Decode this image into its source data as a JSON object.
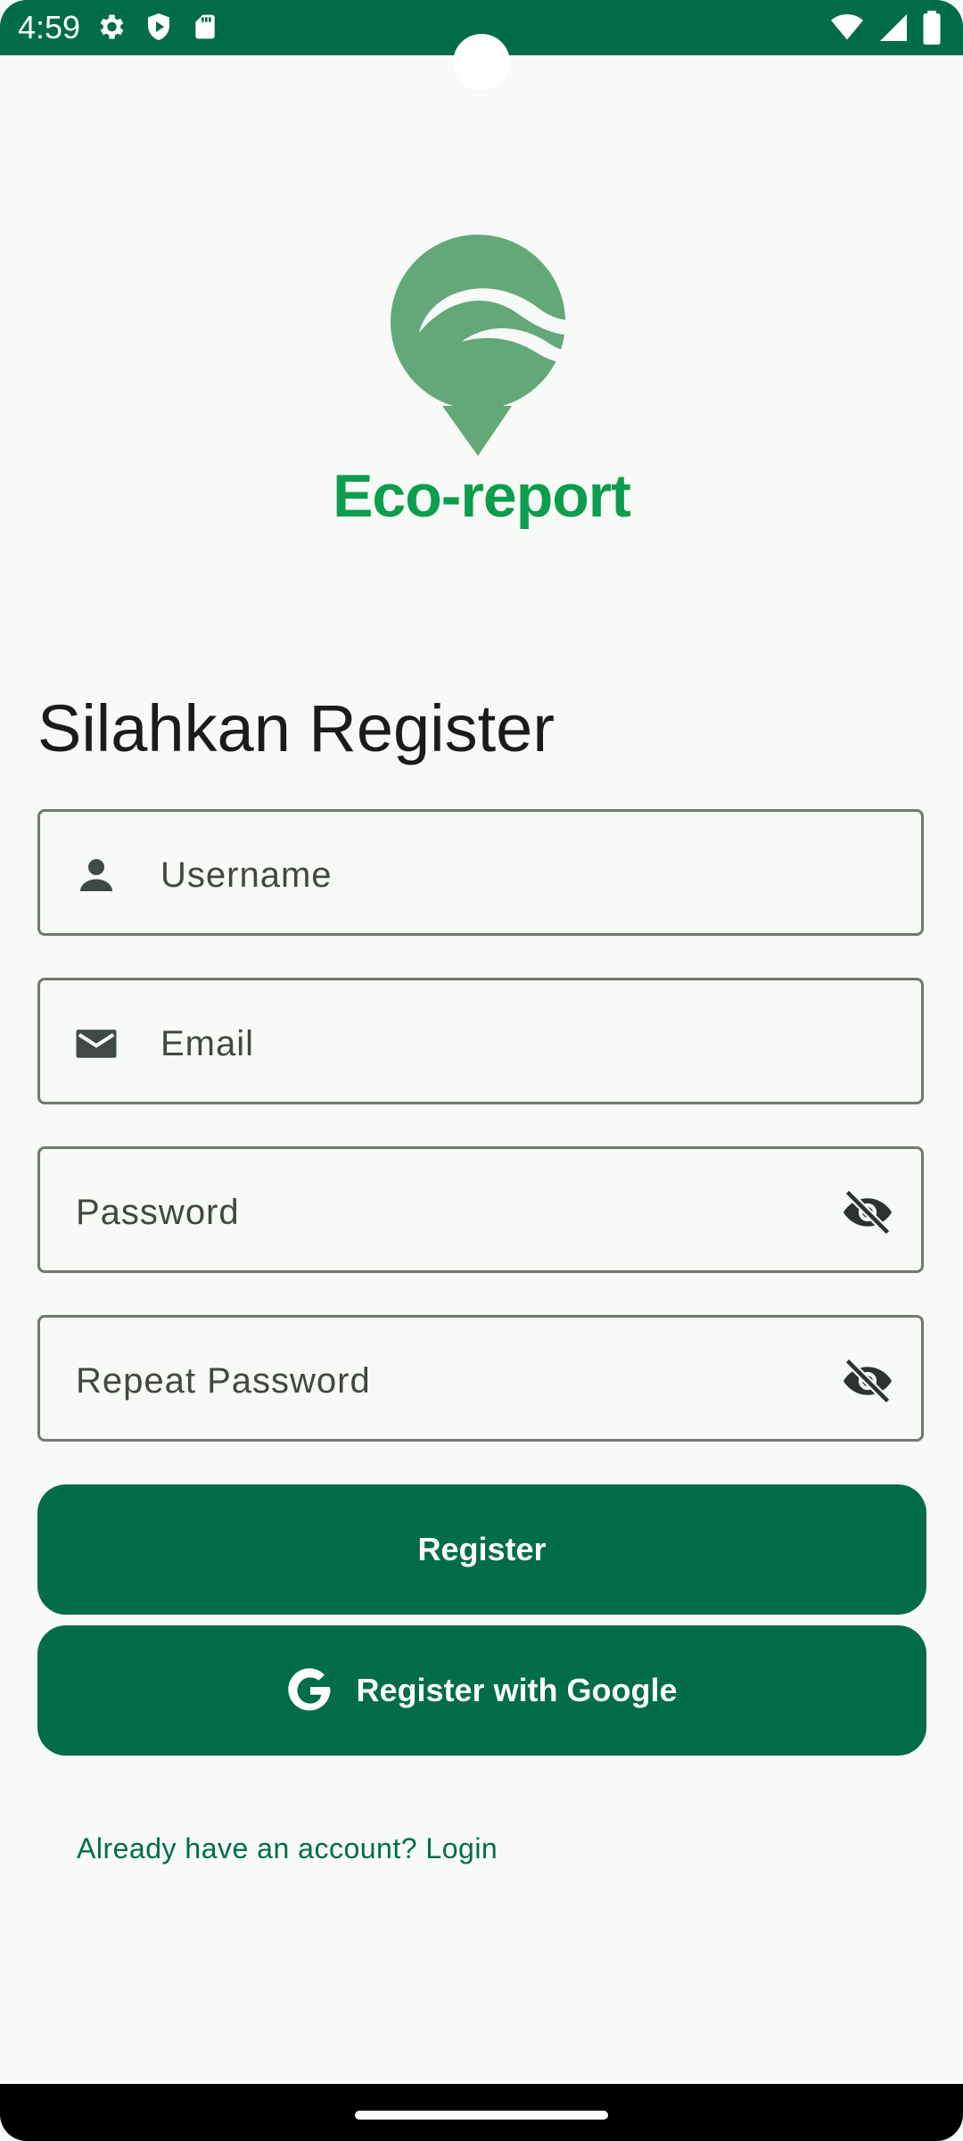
{
  "status_bar": {
    "time": "4:59",
    "left_icons": [
      "gear-icon",
      "shield-play-icon",
      "sd-card-icon"
    ],
    "right_icons": [
      "wifi-icon",
      "signal-icon",
      "battery-icon"
    ]
  },
  "logo": {
    "text": "Eco-report",
    "color": "#0c9d4e",
    "mark_color": "#63a879"
  },
  "heading": "Silahkan Register",
  "form": {
    "username": {
      "placeholder": "Username",
      "icon": "person-icon"
    },
    "email": {
      "placeholder": "Email",
      "icon": "mail-icon"
    },
    "password": {
      "placeholder": "Password",
      "icon": "visibility-off-icon"
    },
    "repeat_password": {
      "placeholder": "Repeat Password",
      "icon": "visibility-off-icon"
    }
  },
  "buttons": {
    "register": "Register",
    "register_google": "Register with Google"
  },
  "login_link": "Already have an account? Login",
  "colors": {
    "primary": "#006d48",
    "background": "#f7faf6",
    "outline": "#737872"
  }
}
